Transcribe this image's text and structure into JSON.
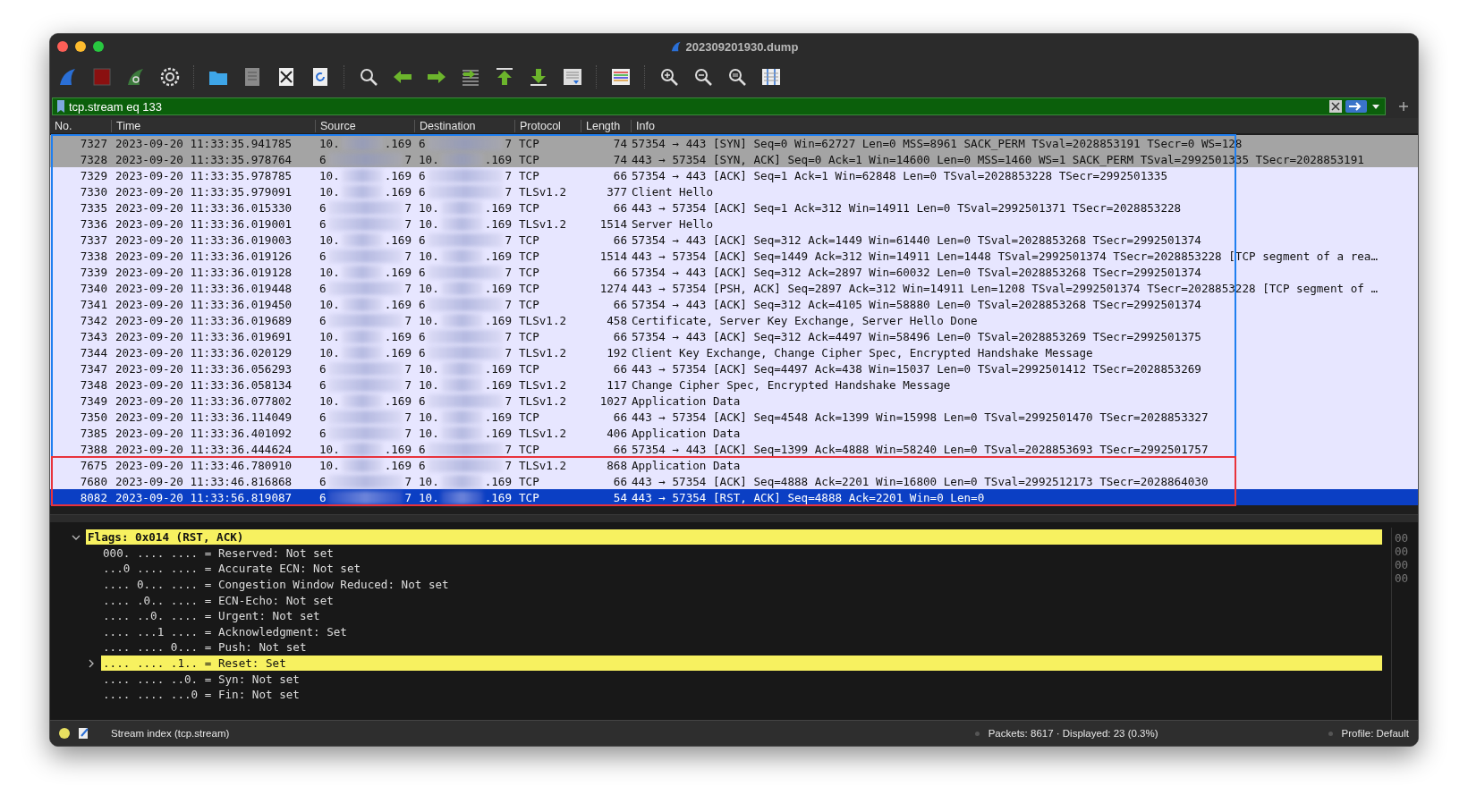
{
  "window": {
    "title": "202309201930.dump"
  },
  "display_filter": {
    "value": "tcp.stream eq 133"
  },
  "packet_list": {
    "columns": [
      "No.",
      "Time",
      "Source",
      "Destination",
      "Protocol",
      "Length",
      "Info"
    ],
    "groups": [
      {
        "color": "#1f7ff0",
        "rows": [
          {
            "no": "7327",
            "time": "2023-09-20 11:33:35.941785",
            "source": {
              "start": "10.",
              "end": ".169"
            },
            "destination": {
              "start": "6",
              "end": "7"
            },
            "protocol": "TCP",
            "length": "74",
            "info": "57354 → 443 [SYN] Seq=0 Win=62727 Len=0 MSS=8961 SACK_PERM TSval=2028853191 TSecr=0 WS=128",
            "color": "#a4a4a4",
            "selected": false
          },
          {
            "no": "7328",
            "time": "2023-09-20 11:33:35.978764",
            "source": {
              "start": "6",
              "end": "7"
            },
            "destination": {
              "start": "10.",
              "end": ".169"
            },
            "protocol": "TCP",
            "length": "74",
            "info": "443 → 57354 [SYN, ACK] Seq=0 Ack=1 Win=14600 Len=0 MSS=1460 WS=1 SACK_PERM TSval=2992501335 TSecr=2028853191",
            "color": "#a4a4a4",
            "selected": false
          },
          {
            "no": "7329",
            "time": "2023-09-20 11:33:35.978785",
            "source": {
              "start": "10.",
              "end": ".169"
            },
            "destination": {
              "start": "6",
              "end": "7"
            },
            "protocol": "TCP",
            "length": "66",
            "info": "57354 → 443 [ACK] Seq=1 Ack=1 Win=62848 Len=0 TSval=2028853228 TSecr=2992501335",
            "color": "#e7e6ff",
            "selected": false
          },
          {
            "no": "7330",
            "time": "2023-09-20 11:33:35.979091",
            "source": {
              "start": "10.",
              "end": ".169"
            },
            "destination": {
              "start": "6",
              "end": "7"
            },
            "protocol": "TLSv1.2",
            "length": "377",
            "info": "Client Hello",
            "color": "#e7e6ff",
            "selected": false
          },
          {
            "no": "7335",
            "time": "2023-09-20 11:33:36.015330",
            "source": {
              "start": "6",
              "end": "7"
            },
            "destination": {
              "start": "10.",
              "end": ".169"
            },
            "protocol": "TCP",
            "length": "66",
            "info": "443 → 57354 [ACK] Seq=1 Ack=312 Win=14911 Len=0 TSval=2992501371 TSecr=2028853228",
            "color": "#e7e6ff",
            "selected": false
          },
          {
            "no": "7336",
            "time": "2023-09-20 11:33:36.019001",
            "source": {
              "start": "6",
              "end": "7"
            },
            "destination": {
              "start": "10.",
              "end": ".169"
            },
            "protocol": "TLSv1.2",
            "length": "1514",
            "info": "Server Hello",
            "color": "#e7e6ff",
            "selected": false
          },
          {
            "no": "7337",
            "time": "2023-09-20 11:33:36.019003",
            "source": {
              "start": "10.",
              "end": ".169"
            },
            "destination": {
              "start": "6",
              "end": "7"
            },
            "protocol": "TCP",
            "length": "66",
            "info": "57354 → 443 [ACK] Seq=312 Ack=1449 Win=61440 Len=0 TSval=2028853268 TSecr=2992501374",
            "color": "#e7e6ff",
            "selected": false
          },
          {
            "no": "7338",
            "time": "2023-09-20 11:33:36.019126",
            "source": {
              "start": "6",
              "end": "7"
            },
            "destination": {
              "start": "10.",
              "end": ".169"
            },
            "protocol": "TCP",
            "length": "1514",
            "info": "443 → 57354 [ACK] Seq=1449 Ack=312 Win=14911 Len=1448 TSval=2992501374 TSecr=2028853228 [TCP segment of a rea…",
            "color": "#e7e6ff",
            "selected": false
          },
          {
            "no": "7339",
            "time": "2023-09-20 11:33:36.019128",
            "source": {
              "start": "10.",
              "end": ".169"
            },
            "destination": {
              "start": "6",
              "end": "7"
            },
            "protocol": "TCP",
            "length": "66",
            "info": "57354 → 443 [ACK] Seq=312 Ack=2897 Win=60032 Len=0 TSval=2028853268 TSecr=2992501374",
            "color": "#e7e6ff",
            "selected": false
          },
          {
            "no": "7340",
            "time": "2023-09-20 11:33:36.019448",
            "source": {
              "start": "6",
              "end": "7"
            },
            "destination": {
              "start": "10.",
              "end": ".169"
            },
            "protocol": "TCP",
            "length": "1274",
            "info": "443 → 57354 [PSH, ACK] Seq=2897 Ack=312 Win=14911 Len=1208 TSval=2992501374 TSecr=2028853228 [TCP segment of …",
            "color": "#e7e6ff",
            "selected": false
          },
          {
            "no": "7341",
            "time": "2023-09-20 11:33:36.019450",
            "source": {
              "start": "10.",
              "end": ".169"
            },
            "destination": {
              "start": "6",
              "end": "7"
            },
            "protocol": "TCP",
            "length": "66",
            "info": "57354 → 443 [ACK] Seq=312 Ack=4105 Win=58880 Len=0 TSval=2028853268 TSecr=2992501374",
            "color": "#e7e6ff",
            "selected": false
          },
          {
            "no": "7342",
            "time": "2023-09-20 11:33:36.019689",
            "source": {
              "start": "6",
              "end": "7"
            },
            "destination": {
              "start": "10.",
              "end": ".169"
            },
            "protocol": "TLSv1.2",
            "length": "458",
            "info": "Certificate, Server Key Exchange, Server Hello Done",
            "color": "#e7e6ff",
            "selected": false
          },
          {
            "no": "7343",
            "time": "2023-09-20 11:33:36.019691",
            "source": {
              "start": "10.",
              "end": ".169"
            },
            "destination": {
              "start": "6",
              "end": "7"
            },
            "protocol": "TCP",
            "length": "66",
            "info": "57354 → 443 [ACK] Seq=312 Ack=4497 Win=58496 Len=0 TSval=2028853269 TSecr=2992501375",
            "color": "#e7e6ff",
            "selected": false
          },
          {
            "no": "7344",
            "time": "2023-09-20 11:33:36.020129",
            "source": {
              "start": "10.",
              "end": ".169"
            },
            "destination": {
              "start": "6",
              "end": "7"
            },
            "protocol": "TLSv1.2",
            "length": "192",
            "info": "Client Key Exchange, Change Cipher Spec, Encrypted Handshake Message",
            "color": "#e7e6ff",
            "selected": false
          },
          {
            "no": "7347",
            "time": "2023-09-20 11:33:36.056293",
            "source": {
              "start": "6",
              "end": "7"
            },
            "destination": {
              "start": "10.",
              "end": ".169"
            },
            "protocol": "TCP",
            "length": "66",
            "info": "443 → 57354 [ACK] Seq=4497 Ack=438 Win=15037 Len=0 TSval=2992501412 TSecr=2028853269",
            "color": "#e7e6ff",
            "selected": false
          },
          {
            "no": "7348",
            "time": "2023-09-20 11:33:36.058134",
            "source": {
              "start": "6",
              "end": "7"
            },
            "destination": {
              "start": "10.",
              "end": ".169"
            },
            "protocol": "TLSv1.2",
            "length": "117",
            "info": "Change Cipher Spec, Encrypted Handshake Message",
            "color": "#e7e6ff",
            "selected": false
          },
          {
            "no": "7349",
            "time": "2023-09-20 11:33:36.077802",
            "source": {
              "start": "10.",
              "end": ".169"
            },
            "destination": {
              "start": "6",
              "end": "7"
            },
            "protocol": "TLSv1.2",
            "length": "1027",
            "info": "Application Data",
            "color": "#e7e6ff",
            "selected": false
          },
          {
            "no": "7350",
            "time": "2023-09-20 11:33:36.114049",
            "source": {
              "start": "6",
              "end": "7"
            },
            "destination": {
              "start": "10.",
              "end": ".169"
            },
            "protocol": "TCP",
            "length": "66",
            "info": "443 → 57354 [ACK] Seq=4548 Ack=1399 Win=15998 Len=0 TSval=2992501470 TSecr=2028853327",
            "color": "#e7e6ff",
            "selected": false
          },
          {
            "no": "7385",
            "time": "2023-09-20 11:33:36.401092",
            "source": {
              "start": "6",
              "end": "7"
            },
            "destination": {
              "start": "10.",
              "end": ".169"
            },
            "protocol": "TLSv1.2",
            "length": "406",
            "info": "Application Data",
            "color": "#e7e6ff",
            "selected": false
          },
          {
            "no": "7388",
            "time": "2023-09-20 11:33:36.444624",
            "source": {
              "start": "10.",
              "end": ".169"
            },
            "destination": {
              "start": "6",
              "end": "7"
            },
            "protocol": "TCP",
            "length": "66",
            "info": "57354 → 443 [ACK] Seq=1399 Ack=4888 Win=58240 Len=0 TSval=2028853693 TSecr=2992501757",
            "color": "#e7e6ff",
            "selected": false
          }
        ]
      },
      {
        "color": "#e8333c",
        "rows": [
          {
            "no": "7675",
            "time": "2023-09-20 11:33:46.780910",
            "source": {
              "start": "10.",
              "end": ".169"
            },
            "destination": {
              "start": "6",
              "end": "7"
            },
            "protocol": "TLSv1.2",
            "length": "868",
            "info": "Application Data",
            "color": "#e7e6ff",
            "selected": false
          },
          {
            "no": "7680",
            "time": "2023-09-20 11:33:46.816868",
            "source": {
              "start": "6",
              "end": "7"
            },
            "destination": {
              "start": "10.",
              "end": ".169"
            },
            "protocol": "TCP",
            "length": "66",
            "info": "443 → 57354 [ACK] Seq=4888 Ack=2201 Win=16800 Len=0 TSval=2992512173 TSecr=2028864030",
            "color": "#e7e6ff",
            "selected": false
          },
          {
            "no": "8082",
            "time": "2023-09-20 11:33:56.819087",
            "source": {
              "start": "6",
              "end": "7"
            },
            "destination": {
              "start": "10.",
              "end": ".169"
            },
            "protocol": "TCP",
            "length": "54",
            "info": "443 → 57354 [RST, ACK] Seq=4888 Ack=2201 Win=0 Len=0",
            "selected": true
          }
        ]
      }
    ]
  },
  "packet_details": [
    {
      "text": "Flags: 0x014 (RST, ACK)",
      "expanded": true,
      "highlighted": true,
      "children": [
        {
          "text": "000. .... .... = Reserved: Not set",
          "highlighted": false
        },
        {
          "text": "...0 .... .... = Accurate ECN: Not set",
          "highlighted": false
        },
        {
          "text": ".... 0... .... = Congestion Window Reduced: Not set",
          "highlighted": false
        },
        {
          "text": ".... .0.. .... = ECN-Echo: Not set",
          "highlighted": false
        },
        {
          "text": ".... ..0. .... = Urgent: Not set",
          "highlighted": false
        },
        {
          "text": ".... ...1 .... = Acknowledgment: Set",
          "highlighted": false
        },
        {
          "text": ".... .... 0... = Push: Not set",
          "highlighted": false
        },
        {
          "text": ".... .... .1.. = Reset: Set",
          "highlighted": true,
          "expanded": false
        },
        {
          "text": ".... .... ..0. = Syn: Not set",
          "highlighted": false
        },
        {
          "text": ".... .... ...0 = Fin: Not set",
          "highlighted": false
        }
      ]
    }
  ],
  "hex_pane": {
    "lines": [
      "00",
      "00",
      "00",
      "00"
    ]
  },
  "status_bar": {
    "field": "Stream index (tcp.stream)",
    "packets": "Packets: 8617 · Displayed: 23 (0.3%)",
    "profile": "Profile: Default"
  }
}
